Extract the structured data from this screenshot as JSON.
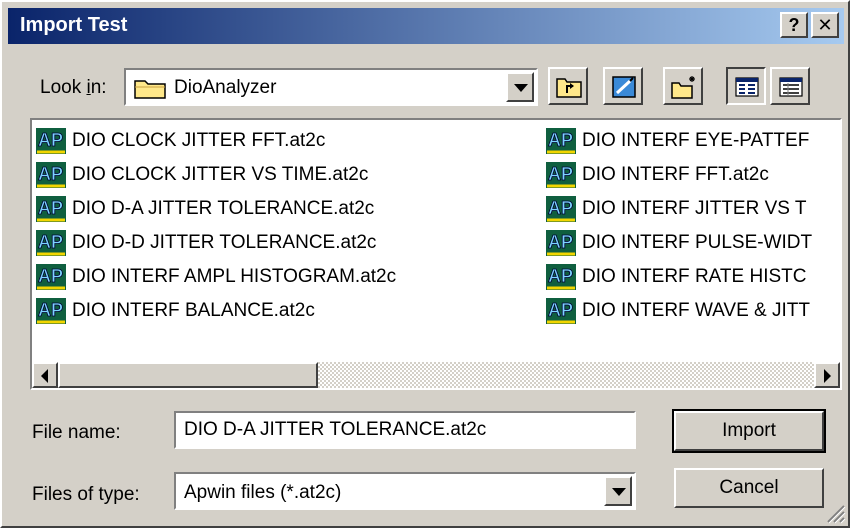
{
  "window": {
    "title": "Import Test",
    "help_label": "?",
    "close_label": "✕"
  },
  "lookin": {
    "label": "Look in:",
    "mnemonic": "i",
    "value": "DioAnalyzer"
  },
  "toolbar": {
    "buttons": [
      {
        "name": "up-one-level-icon"
      },
      {
        "name": "desktop-icon"
      },
      {
        "name": "new-folder-icon"
      },
      {
        "name": "list-view-icon"
      },
      {
        "name": "details-view-icon"
      }
    ]
  },
  "files": {
    "column1": [
      "DIO CLOCK JITTER FFT.at2c",
      "DIO CLOCK JITTER VS TIME.at2c",
      "DIO D-A JITTER TOLERANCE.at2c",
      "DIO D-D JITTER TOLERANCE.at2c",
      "DIO INTERF AMPL HISTOGRAM.at2c",
      "DIO INTERF BALANCE.at2c"
    ],
    "column2": [
      "DIO INTERF EYE-PATTEF",
      "DIO INTERF FFT.at2c",
      "DIO INTERF JITTER VS T",
      "DIO INTERF PULSE-WIDT",
      "DIO INTERF RATE HISTC",
      "DIO INTERF WAVE & JITT"
    ],
    "icon": "apwin-file-icon",
    "selected": "DIO D-A JITTER TOLERANCE.at2c"
  },
  "filename": {
    "label": "File name:",
    "value": "DIO D-A JITTER TOLERANCE.at2c"
  },
  "filetype": {
    "label": "Files of type:",
    "value": "Apwin files (*.at2c)"
  },
  "buttons": {
    "import": "Import",
    "cancel": "Cancel"
  },
  "colors": {
    "title_start": "#0a246a",
    "title_end": "#a6caf0",
    "face": "#d4d0c8"
  }
}
